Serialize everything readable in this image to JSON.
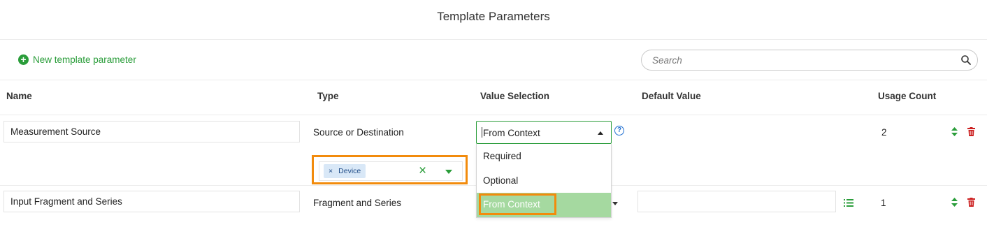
{
  "page": {
    "title": "Template Parameters"
  },
  "toolbar": {
    "new_param_label": "New template parameter",
    "search_placeholder": "Search"
  },
  "columns": [
    "Name",
    "Type",
    "Value Selection",
    "Default Value",
    "Usage Count"
  ],
  "rows": [
    {
      "name": "Measurement Source",
      "type": "Source or Destination",
      "value_selection": "From Context",
      "default_value": "",
      "usage_count": "2",
      "chip": "Device"
    },
    {
      "name": "Input Fragment and Series",
      "type": "Fragment and Series",
      "value_selection": "From Context",
      "default_value": "",
      "usage_count": "1"
    }
  ],
  "dropdown": {
    "options": [
      "Required",
      "Optional",
      "From Context"
    ],
    "selected": "From Context"
  },
  "colors": {
    "accent": "#2a9d3a",
    "highlight": "#f28b0c",
    "delete": "#cc1f1f",
    "help": "#1f6fd1",
    "selected_option": "#a5d9a0"
  },
  "icons": [
    "plus-circle-icon",
    "search-icon",
    "help-icon",
    "caret-up-icon",
    "clear-icon",
    "caret-down-icon",
    "sort-icon",
    "trash-icon",
    "list-icon"
  ]
}
